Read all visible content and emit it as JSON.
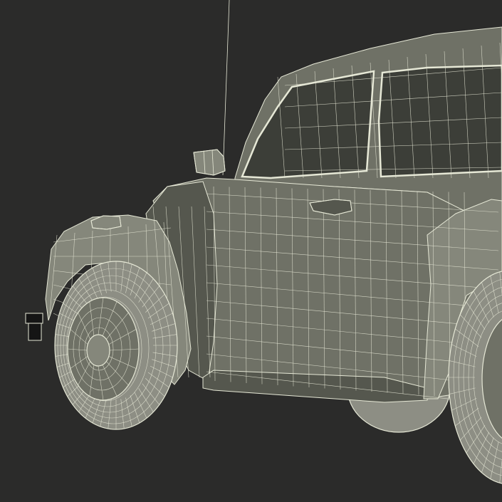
{
  "scene": {
    "subject": "car-wireframe-render",
    "colors": {
      "background": "#2b2b2a",
      "body": "#6f7166",
      "body_shadow": "#55574e",
      "body_light": "#85877b",
      "wire": "#e6e8d6",
      "glass": "#3c3e38",
      "tire": "#8d8e84",
      "dark": "#151515"
    }
  }
}
